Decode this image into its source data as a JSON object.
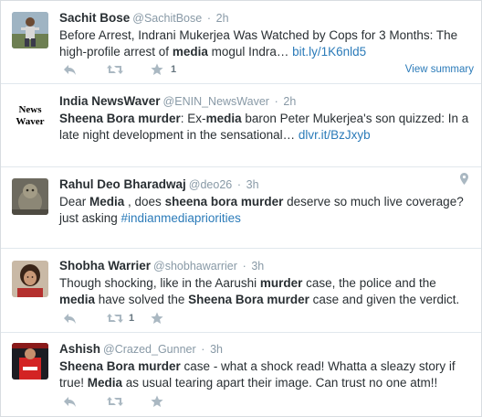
{
  "tweets": [
    {
      "fullname": "Sachit Bose",
      "username": "@SachitBose",
      "time": "2h",
      "text_parts": [
        "Before Arrest, Indrani Mukerjea Was Watched by Cops for 3 Months: The high-profile arrest of ",
        "media",
        " mogul Indra… "
      ],
      "link": "bit.ly/1K6nld5",
      "favorite_count": "1",
      "retweet_count": "",
      "view_summary": "View summary",
      "avatar_icon": "person-photo-avatar"
    },
    {
      "fullname": "India NewsWaver",
      "username": "@ENIN_NewsWaver",
      "time": "2h",
      "text_parts": [
        "Sheena Bora murder",
        ": Ex-",
        "media",
        " baron Peter Mukerjea's son quizzed: In a late night development in the sensational… "
      ],
      "link": "dlvr.it/BzJxyb",
      "avatar_text_line1": "News",
      "avatar_text_line2": "Waver"
    },
    {
      "fullname": "Rahul Deo Bharadwaj",
      "username": "@deo26",
      "time": "3h",
      "text_parts": [
        "Dear ",
        "Media",
        " , does ",
        "sheena bora murder",
        " deserve so much live coverage? just asking "
      ],
      "link": "#indianmediapriorities",
      "geo_icon": "location-pin-icon"
    },
    {
      "fullname": "Shobha Warrier",
      "username": "@shobhawarrier",
      "time": "3h",
      "text_parts": [
        "Though shocking, like in the Aarushi ",
        "murder",
        " case, the police and the ",
        "media",
        " have solved the ",
        "Sheena Bora murder",
        " case and given the verdict."
      ],
      "retweet_count": "1"
    },
    {
      "fullname": "Ashish",
      "username": "@Crazed_Gunner",
      "time": "3h",
      "text_parts": [
        "Sheena Bora murder",
        " case - what a shock read! Whatta a sleazy story if true! ",
        "Media",
        " as usual tearing apart their image. Can trust no one atm!!"
      ]
    }
  ],
  "separator": "·",
  "colors": {
    "link": "#2b7bb9",
    "action_icon": "#aab8c2",
    "meta": "#8899a6"
  }
}
